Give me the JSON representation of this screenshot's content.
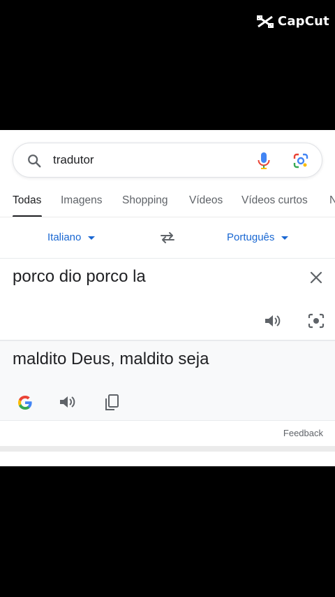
{
  "watermark": {
    "text": "CapCut",
    "icon": "capcut-logo-icon"
  },
  "search": {
    "value": "tradutor",
    "icons": [
      "search-icon",
      "mic-icon",
      "lens-icon"
    ]
  },
  "tabs": [
    {
      "label": "Todas",
      "active": true
    },
    {
      "label": "Imagens",
      "active": false
    },
    {
      "label": "Shopping",
      "active": false
    },
    {
      "label": "Vídeos",
      "active": false
    },
    {
      "label": "Vídeos curtos",
      "active": false
    },
    {
      "label": "N",
      "active": false
    }
  ],
  "translator": {
    "source_language": "Italiano",
    "target_language": "Português",
    "source_text": "porco dio porco la",
    "target_text": "maldito Deus, maldito seja",
    "feedback_label": "Feedback"
  },
  "colors": {
    "accent_blue": "#1967d2",
    "text_primary": "#202124",
    "text_secondary": "#5f6368"
  }
}
